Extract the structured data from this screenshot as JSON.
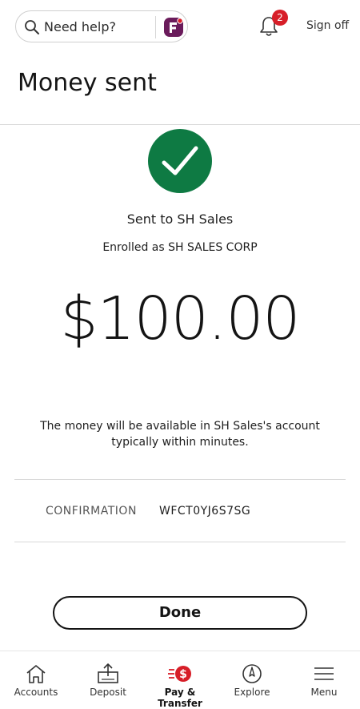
{
  "header": {
    "search_label": "Need help?",
    "notification_count": "2",
    "sign_off_label": "Sign off",
    "page_title": "Money sent"
  },
  "confirmation": {
    "sent_to": "Sent to SH Sales",
    "enrolled_as": "Enrolled as SH SALES CORP",
    "amount": "$100.00",
    "availability_line1": "The money will be available in SH Sales's account",
    "availability_line2": "typically within minutes.",
    "confirmation_label": "CONFIRMATION",
    "confirmation_number": "WFCT0YJ6S7SG",
    "done_label": "Done"
  },
  "bottom_nav": {
    "items": [
      {
        "label": "Accounts",
        "icon": "home-icon"
      },
      {
        "label": "Deposit",
        "icon": "deposit-icon"
      },
      {
        "label": "Pay & Transfer",
        "icon": "pay-transfer-icon",
        "active": true
      },
      {
        "label": "Explore",
        "icon": "compass-icon"
      },
      {
        "label": "Menu",
        "icon": "menu-icon"
      }
    ]
  },
  "colors": {
    "success_green": "#0e7a43",
    "brand_red": "#d71e28",
    "brand_purple": "#6a1b5b"
  }
}
